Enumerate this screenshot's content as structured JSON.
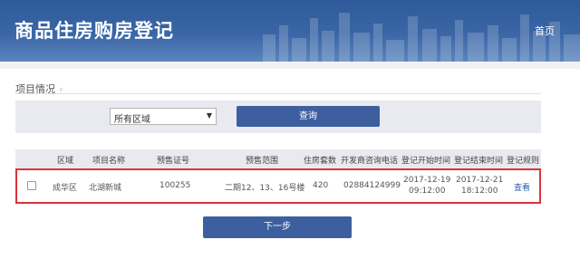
{
  "header": {
    "title": "商品住房购房登记",
    "home_link": "首页"
  },
  "section": {
    "title": "项目情况",
    "chevron_icon": "chevron-right-icon"
  },
  "filter": {
    "area_select_value": "所有区域",
    "query_button": "查询"
  },
  "table": {
    "headers": [
      "区域",
      "项目名称",
      "预售证号",
      "预售范围",
      "住房套数",
      "开发商咨询电话",
      "登记开始时间",
      "登记结束时间",
      "登记规则"
    ],
    "rows": [
      {
        "area": "成华区",
        "project": "北湖新城",
        "permit": "100255",
        "scope": "二期12、13、16号楼",
        "units": "420",
        "phone": "02884124999",
        "start_date": "2017-12-19",
        "start_time": "09:12:00",
        "end_date": "2017-12-21",
        "end_time": "18:12:00",
        "rules_link": "查看"
      }
    ]
  },
  "next_button": "下一步",
  "colors": {
    "header_blue": "#3a66a6",
    "button_blue": "#3d5fa0",
    "highlight_red": "#d9333b",
    "link_blue": "#2a5db0"
  }
}
